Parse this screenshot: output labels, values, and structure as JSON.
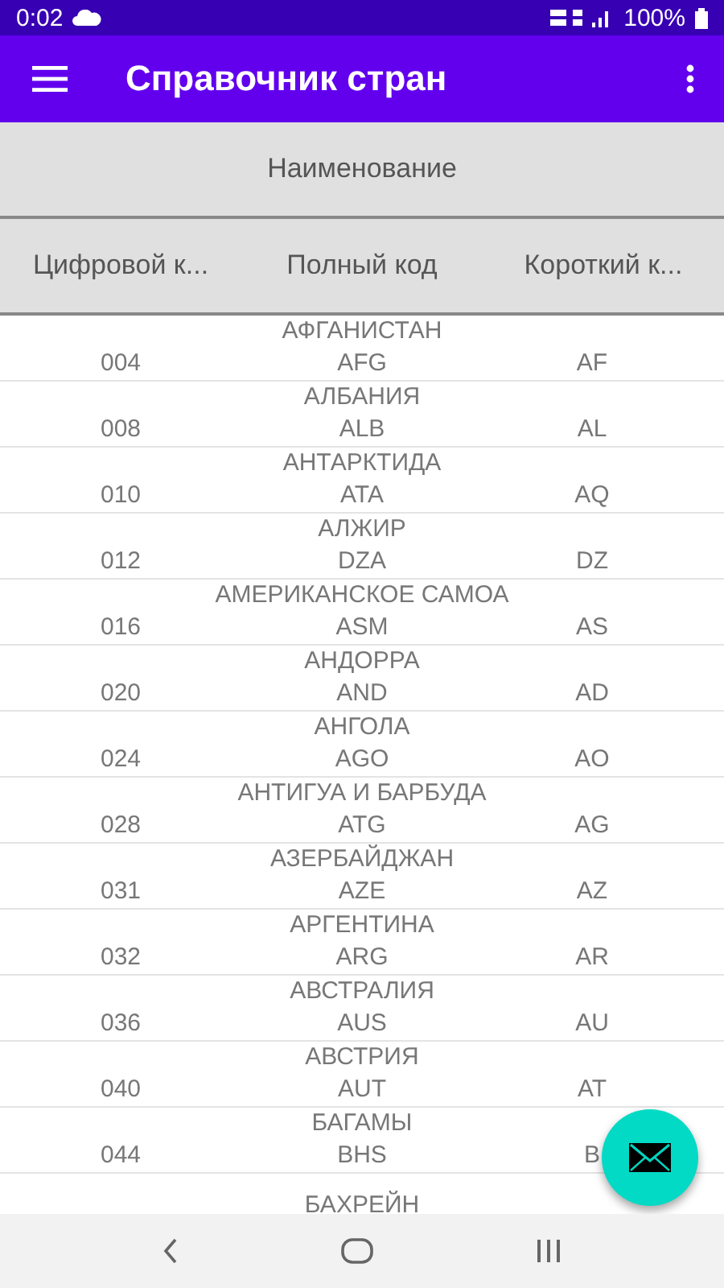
{
  "status_bar": {
    "time": "0:02",
    "battery": "100%"
  },
  "app_bar": {
    "title": "Справочник стран"
  },
  "table": {
    "name_header": "Наименование",
    "columns": [
      "Цифровой к...",
      "Полный код",
      "Короткий к..."
    ],
    "rows": [
      {
        "name": "АФГАНИСТАН",
        "numeric": "004",
        "full": "AFG",
        "short": "AF"
      },
      {
        "name": "АЛБАНИЯ",
        "numeric": "008",
        "full": "ALB",
        "short": "AL"
      },
      {
        "name": "АНТАРКТИДА",
        "numeric": "010",
        "full": "ATA",
        "short": "AQ"
      },
      {
        "name": "АЛЖИР",
        "numeric": "012",
        "full": "DZA",
        "short": "DZ"
      },
      {
        "name": "АМЕРИКАНСКОЕ САМОА",
        "numeric": "016",
        "full": "ASM",
        "short": "AS"
      },
      {
        "name": "АНДОРРА",
        "numeric": "020",
        "full": "AND",
        "short": "AD"
      },
      {
        "name": "АНГОЛА",
        "numeric": "024",
        "full": "AGO",
        "short": "AO"
      },
      {
        "name": "АНТИГУА И БАРБУДА",
        "numeric": "028",
        "full": "ATG",
        "short": "AG"
      },
      {
        "name": "АЗЕРБАЙДЖАН",
        "numeric": "031",
        "full": "AZE",
        "short": "AZ"
      },
      {
        "name": "АРГЕНТИНА",
        "numeric": "032",
        "full": "ARG",
        "short": "AR"
      },
      {
        "name": "АВСТРАЛИЯ",
        "numeric": "036",
        "full": "AUS",
        "short": "AU"
      },
      {
        "name": "АВСТРИЯ",
        "numeric": "040",
        "full": "AUT",
        "short": "AT"
      },
      {
        "name": "БАГАМЫ",
        "numeric": "044",
        "full": "BHS",
        "short": "B"
      },
      {
        "name": "БАХРЕЙН"
      }
    ]
  }
}
